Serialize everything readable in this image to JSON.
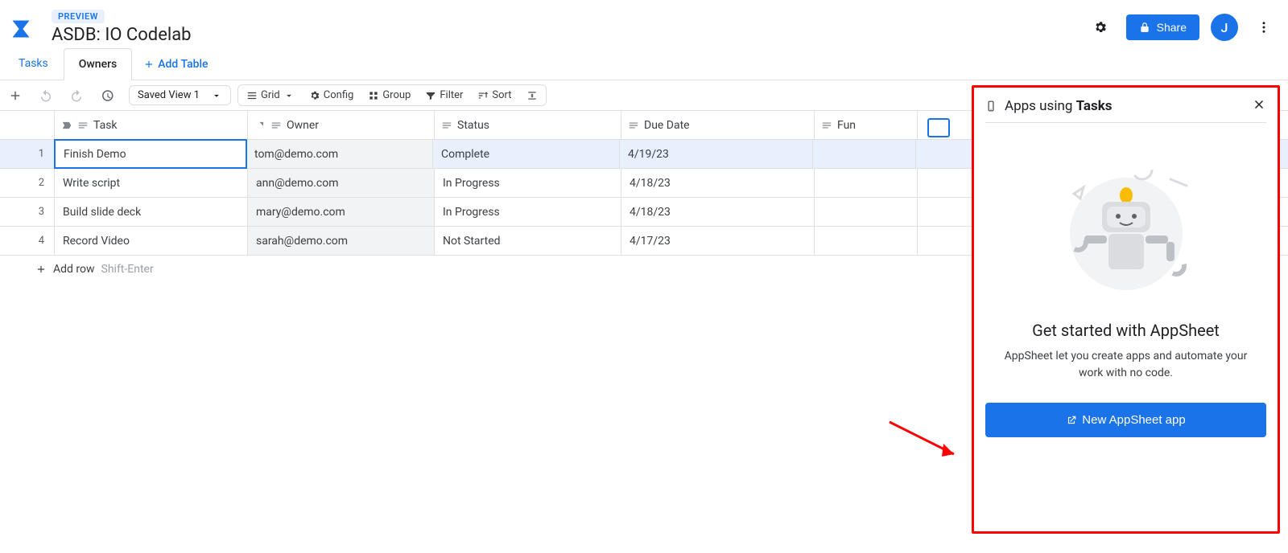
{
  "header": {
    "badge": "PREVIEW",
    "title": "ASDB: IO Codelab",
    "share": "Share",
    "avatar": "J"
  },
  "tabs": {
    "tasks": "Tasks",
    "owners": "Owners",
    "add_table": "Add Table"
  },
  "toolbar": {
    "saved_view": "Saved View 1",
    "grid": "Grid",
    "config": "Config",
    "group": "Group",
    "filter": "Filter",
    "sort": "Sort"
  },
  "columns": {
    "task": "Task",
    "owner": "Owner",
    "status": "Status",
    "due": "Due Date",
    "fun": "Fun"
  },
  "rows": [
    {
      "n": "1",
      "task": "Finish Demo",
      "owner": "tom@demo.com",
      "status": "Complete",
      "due": "4/19/23",
      "fun": ""
    },
    {
      "n": "2",
      "task": "Write script",
      "owner": "ann@demo.com",
      "status": "In Progress",
      "due": "4/18/23",
      "fun": ""
    },
    {
      "n": "3",
      "task": "Build slide deck",
      "owner": "mary@demo.com",
      "status": "In Progress",
      "due": "4/18/23",
      "fun": ""
    },
    {
      "n": "4",
      "task": "Record Video",
      "owner": "sarah@demo.com",
      "status": "Not Started",
      "due": "4/17/23",
      "fun": ""
    }
  ],
  "add_row": {
    "label": "Add row",
    "hint": "Shift-Enter"
  },
  "panel": {
    "title_prefix": "Apps using ",
    "title_bold": "Tasks",
    "heading": "Get started with AppSheet",
    "desc": "AppSheet let you create apps and automate your work with no code.",
    "button": "New AppSheet app"
  }
}
